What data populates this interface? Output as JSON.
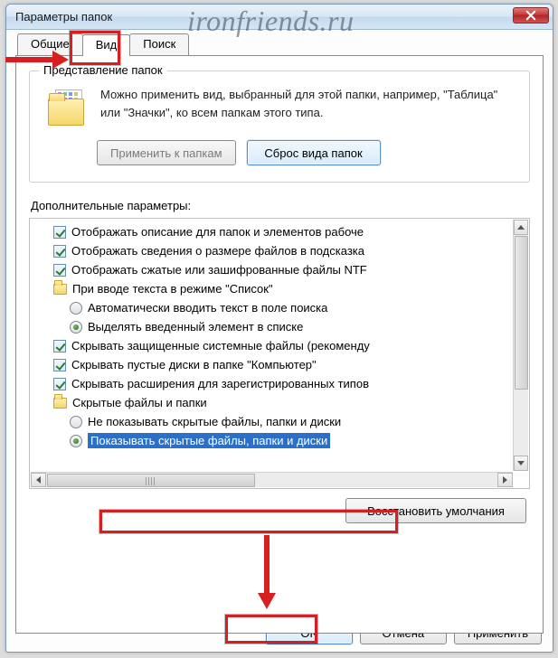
{
  "watermark": "ironfriends.ru",
  "window": {
    "title": "Параметры папок"
  },
  "tabs": {
    "general": "Общие",
    "view": "Вид",
    "search": "Поиск"
  },
  "group": {
    "title": "Представление папок",
    "text": "Можно применить вид, выбранный для этой папки, например, \"Таблица\" или \"Значки\", ко всем папкам этого типа.",
    "apply_btn": "Применить к папкам",
    "reset_btn": "Сброс вида папок"
  },
  "advanced": {
    "label": "Дополнительные параметры:",
    "items": [
      {
        "kind": "check",
        "lvl": 1,
        "checked": true,
        "label": "Отображать описание для папок и элементов рабоче"
      },
      {
        "kind": "check",
        "lvl": 1,
        "checked": true,
        "label": "Отображать сведения о размере файлов в подсказка"
      },
      {
        "kind": "check",
        "lvl": 1,
        "checked": true,
        "label": "Отображать сжатые или зашифрованные файлы NTF"
      },
      {
        "kind": "folder",
        "lvl": 1,
        "label": "При вводе текста в режиме \"Список\""
      },
      {
        "kind": "radio",
        "lvl": 2,
        "checked": false,
        "label": "Автоматически вводить текст в поле поиска"
      },
      {
        "kind": "radio",
        "lvl": 2,
        "checked": true,
        "label": "Выделять введенный элемент в списке"
      },
      {
        "kind": "check",
        "lvl": 1,
        "checked": true,
        "label": "Скрывать защищенные системные файлы (рекоменду"
      },
      {
        "kind": "check",
        "lvl": 1,
        "checked": true,
        "label": "Скрывать пустые диски в папке \"Компьютер\""
      },
      {
        "kind": "check",
        "lvl": 1,
        "checked": true,
        "label": "Скрывать расширения для зарегистрированных типов"
      },
      {
        "kind": "folder",
        "lvl": 1,
        "label": "Скрытые файлы и папки"
      },
      {
        "kind": "radio",
        "lvl": 2,
        "checked": false,
        "label": "Не показывать скрытые файлы, папки и диски"
      },
      {
        "kind": "radio",
        "lvl": 2,
        "checked": true,
        "selected": true,
        "label": "Показывать скрытые файлы, папки и диски"
      }
    ],
    "restore_btn": "Восстановить умолчания"
  },
  "dialog": {
    "ok": "OK",
    "cancel": "Отмена",
    "apply": "Применить"
  }
}
